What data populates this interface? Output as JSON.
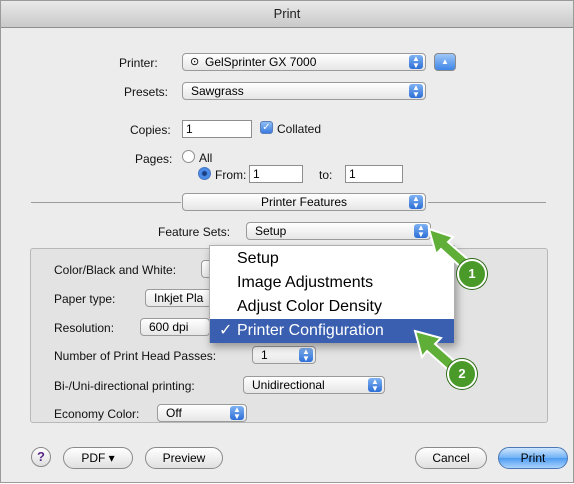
{
  "window": {
    "title": "Print"
  },
  "printer": {
    "label": "Printer:",
    "value": "GelSprinter GX 7000"
  },
  "presets": {
    "label": "Presets:",
    "value": "Sawgrass"
  },
  "copies": {
    "label": "Copies:",
    "value": "1",
    "collated_label": "Collated",
    "collated": true
  },
  "pages": {
    "label": "Pages:",
    "all_label": "All",
    "from_label": "From:",
    "from_value": "1",
    "to_label": "to:",
    "to_value": "1",
    "selected": "from"
  },
  "section": {
    "value": "Printer Features"
  },
  "feature_sets": {
    "label": "Feature Sets:",
    "value": "Setup"
  },
  "features": {
    "color_bw_label": "Color/Black and White:",
    "paper_type_label": "Paper type:",
    "paper_type_value": "Inkjet Pla",
    "resolution_label": "Resolution:",
    "resolution_value": "600 dpi",
    "head_passes_label": "Number of Print Head Passes:",
    "head_passes_value": "1",
    "bidi_label": "Bi-/Uni-directional printing:",
    "bidi_value": "Unidirectional",
    "economy_label": "Economy Color:",
    "economy_value": "Off"
  },
  "menu": {
    "items": [
      {
        "label": "Setup"
      },
      {
        "label": "Image Adjustments"
      },
      {
        "label": "Adjust Color Density"
      },
      {
        "label": "Printer Configuration",
        "selected": true
      }
    ],
    "check_glyph": "✓"
  },
  "callouts": {
    "badge1": "1",
    "badge2": "2",
    "color": "#4a9a2a"
  },
  "footer": {
    "help": "?",
    "pdf": "PDF ▾",
    "preview": "Preview",
    "cancel": "Cancel",
    "print": "Print"
  },
  "accent": "#3a5fb0"
}
